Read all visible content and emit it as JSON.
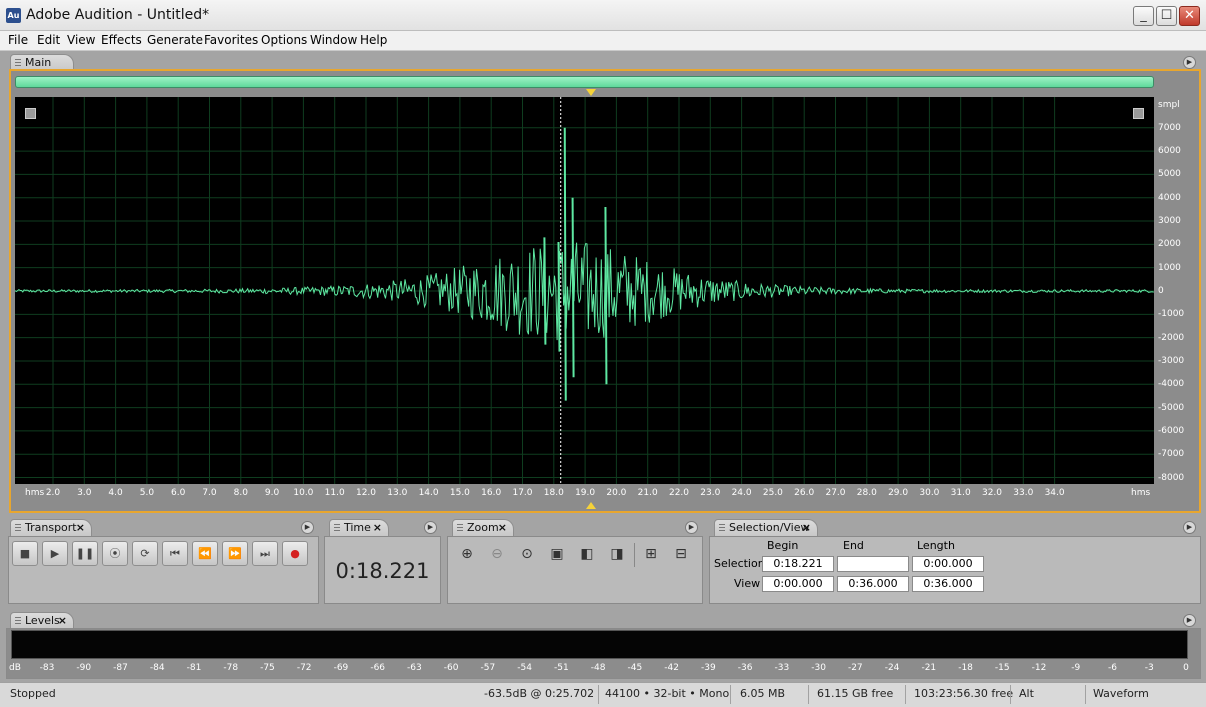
{
  "window": {
    "title": "Adobe Audition - Untitled*",
    "icon_text": "Au"
  },
  "menu": [
    "File",
    "Edit",
    "View",
    "Effects",
    "Generate",
    "Favorites",
    "Options",
    "Window",
    "Help"
  ],
  "main_panel": {
    "tab": "Main"
  },
  "waveform": {
    "y_unit": "smpl",
    "y_ticks": [
      "7000",
      "6000",
      "5000",
      "4000",
      "3000",
      "2000",
      "1000",
      "0",
      "-1000",
      "-2000",
      "-3000",
      "-4000",
      "-5000",
      "-6000",
      "-7000",
      "-8000"
    ],
    "x_unit_left": "hms",
    "x_unit_right": "hms",
    "x_ticks": [
      "2.0",
      "3.0",
      "4.0",
      "5.0",
      "6.0",
      "7.0",
      "8.0",
      "9.0",
      "10.0",
      "11.0",
      "12.0",
      "13.0",
      "14.0",
      "15.0",
      "16.0",
      "17.0",
      "18.0",
      "19.0",
      "20.0",
      "21.0",
      "22.0",
      "23.0",
      "24.0",
      "25.0",
      "26.0",
      "27.0",
      "28.0",
      "29.0",
      "30.0",
      "31.0",
      "32.0",
      "33.0",
      "34.0"
    ],
    "playhead_sec": 18.221,
    "view_end_sec": 36.0,
    "color": "#5ee8a2"
  },
  "transport": {
    "tab": "Transport",
    "buttons": [
      "stop",
      "play",
      "pause",
      "play-to-end",
      "loop",
      "go-to-start",
      "rewind",
      "fast-forward",
      "go-to-end",
      "record"
    ]
  },
  "time": {
    "tab": "Time",
    "value": "0:18.221"
  },
  "zoom": {
    "tab": "Zoom"
  },
  "selection_view": {
    "tab": "Selection/View",
    "col_begin": "Begin",
    "col_end": "End",
    "col_length": "Length",
    "row_selection": "Selection",
    "row_view": "View",
    "sel_begin": "0:18.221",
    "sel_end": "",
    "sel_length": "0:00.000",
    "view_begin": "0:00.000",
    "view_end": "0:36.000",
    "view_length": "0:36.000"
  },
  "levels": {
    "tab": "Levels",
    "scale": [
      "dB",
      "-83",
      "-90",
      "-87",
      "-84",
      "-81",
      "-78",
      "-75",
      "-72",
      "-69",
      "-66",
      "-63",
      "-60",
      "-57",
      "-54",
      "-51",
      "-48",
      "-45",
      "-42",
      "-39",
      "-36",
      "-33",
      "-30",
      "-27",
      "-24",
      "-21",
      "-18",
      "-15",
      "-12",
      "-9",
      "-6",
      "-3",
      "0"
    ]
  },
  "status": {
    "state": "Stopped",
    "peak": "-63.5dB @  0:25.702",
    "format": "44100 • 32-bit • Mono",
    "size": "6.05 MB",
    "free": "61.15 GB free",
    "time_free": "103:23:56.30 free",
    "modifier": "Alt",
    "view": "Waveform"
  }
}
